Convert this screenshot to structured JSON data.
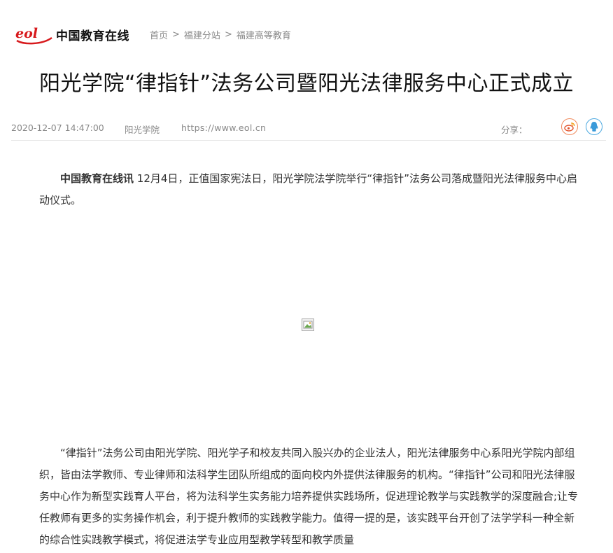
{
  "header": {
    "logo_mark": "eol",
    "logo_text": "中国教育在线",
    "breadcrumb": {
      "home": "首页",
      "sep1": ">",
      "branch": "福建分站",
      "sep2": ">",
      "section": "福建高等教育"
    }
  },
  "article": {
    "title": "阳光学院“律指针”法务公司暨阳光法律服务中心正式成立",
    "meta": {
      "date": "2020-12-07 14:47:00",
      "source": "阳光学院",
      "url": "https://www.eol.cn",
      "share_label": "分享："
    },
    "share_icons": [
      "weibo-icon",
      "qq-icon"
    ],
    "lead_source": "中国教育在线讯",
    "para1_text": " 12月4日，正值国家宪法日，阳光学院法学院举行“律指针”法务公司落成暨阳光法律服务中心启动仪式。",
    "para2_text": "“律指针”法务公司由阳光学院、阳光学子和校友共同入股兴办的企业法人，阳光法律服务中心系阳光学院内部组织，皆由法学教师、专业律师和法科学生团队所组成的面向校内外提供法律服务的机构。“律指针”公司和阳光法律服务中心作为新型实践育人平台，将为法科学生实务能力培养提供实践场所，促进理论教学与实践教学的深度融合;让专任教师有更多的实务操作机会，利于提升教师的实践教学能力。值得一提的是，该实践平台开创了法学学科一种全新的综合性实践教学模式，将促进法学专业应用型教学转型和教学质量"
  },
  "colors": {
    "logo_red": "#d7191c",
    "weibo_orange": "#f08a5d",
    "qq_blue": "#4aa8e0",
    "meta_grey": "#888888"
  }
}
